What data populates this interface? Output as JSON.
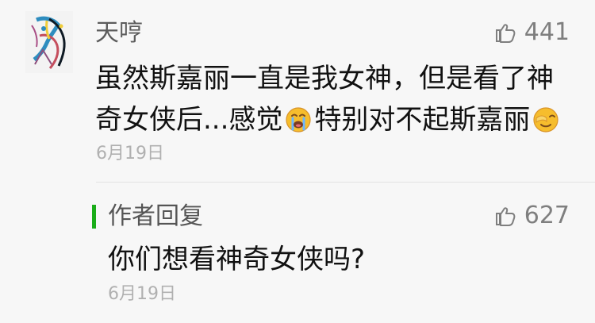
{
  "comment": {
    "username": "天哼",
    "likes": "441",
    "lines": [
      {
        "before": "虽然斯嘉丽一直是我女神，但是看了神",
        "emoji": "",
        "after": ""
      },
      {
        "before": "奇女侠后...感觉",
        "emoji": "crying-face-emoji",
        "after": "特别对不起斯嘉丽",
        "emoji_end": "face-palm-emoji"
      }
    ],
    "date": "6月19日"
  },
  "reply": {
    "label": "作者回复",
    "likes": "627",
    "text": "你们想看神奇女侠吗?",
    "date": "6月19日"
  },
  "colors": {
    "background": "#f7f7f7",
    "reply_bar": "#1aad19",
    "meta_text": "#7f7f7f",
    "date_text": "#b0b0b0"
  },
  "icons": {
    "thumbs_up": "thumbs-up-icon",
    "avatar": "abstract-art-avatar"
  }
}
